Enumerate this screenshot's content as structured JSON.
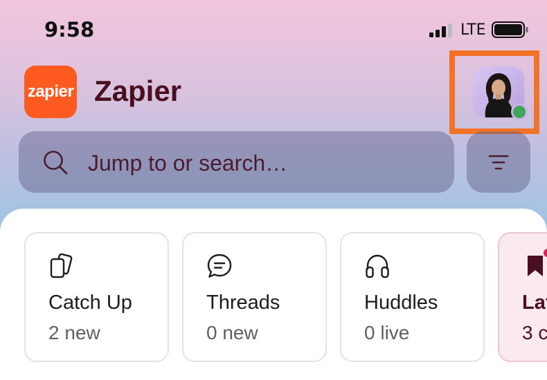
{
  "status_bar": {
    "time": "9:58",
    "carrier": "LTE",
    "icons": [
      "signal-icon",
      "battery-icon"
    ]
  },
  "header": {
    "logo_text": "zapier",
    "workspace_name": "Zapier",
    "avatar": {
      "presence": "online"
    }
  },
  "colors": {
    "brand": "#ff5a1f",
    "title": "#4a1020",
    "highlight": "#f27327",
    "presence_online": "#3fa55b",
    "badge": "#e01e5a"
  },
  "search": {
    "placeholder": "Jump to or search…",
    "icon": "search-icon"
  },
  "filter": {
    "icon": "filter-icon"
  },
  "cards": [
    {
      "icon": "catch-up-icon",
      "title": "Catch Up",
      "subtitle": "2 new"
    },
    {
      "icon": "threads-icon",
      "title": "Threads",
      "subtitle": "0 new"
    },
    {
      "icon": "huddles-icon",
      "title": "Huddles",
      "subtitle": "0 live"
    },
    {
      "icon": "bookmark-icon",
      "title": "Lat",
      "subtitle": "3 c"
    }
  ]
}
